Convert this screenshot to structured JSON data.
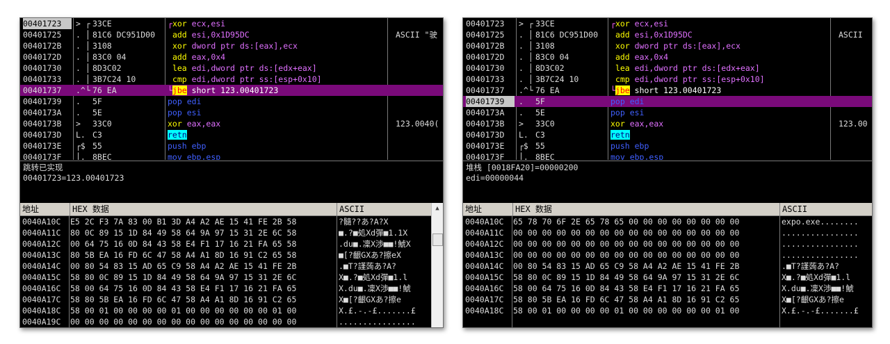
{
  "left": {
    "rows": [
      {
        "addr": "00401723",
        "mark": "> ┌",
        "hex": "33CE",
        "asm": "┌xor ecx,esi",
        "cmt": "",
        "sel": false,
        "hl": true
      },
      {
        "addr": "00401725",
        "mark": ". │",
        "hex": "81C6 DC951D00",
        "asm": " add esi,0x1D95DC",
        "cmt": "ASCII \"驶",
        "sel": false,
        "hl": false
      },
      {
        "addr": "0040172B",
        "mark": ". │",
        "hex": "3108",
        "asm": " xor dword ptr ds:[eax],ecx",
        "cmt": "",
        "sel": false,
        "hl": false
      },
      {
        "addr": "0040172D",
        "mark": ". │",
        "hex": "83C0 04",
        "asm": " add eax,0x4",
        "cmt": "",
        "sel": false,
        "hl": false
      },
      {
        "addr": "00401730",
        "mark": ". │",
        "hex": "8D3C02",
        "asm": " lea edi,dword ptr ds:[edx+eax]",
        "cmt": "",
        "sel": false,
        "hl": false
      },
      {
        "addr": "00401733",
        "mark": ". │",
        "hex": "3B7C24 10",
        "asm": " cmp edi,dword ptr ss:[esp+0x10]",
        "cmt": "",
        "sel": false,
        "hl": false
      },
      {
        "addr": "00401737",
        "mark": ".^└",
        "hex": "76 EA",
        "asm": "└jbe short 123.00401723",
        "cmt": "",
        "sel": true,
        "hl": false
      },
      {
        "addr": "00401739",
        "mark": ".",
        "hex": "5F",
        "asm": "pop edi",
        "cmt": "",
        "sel": false,
        "hl": false
      },
      {
        "addr": "0040173A",
        "mark": ".",
        "hex": "5E",
        "asm": "pop esi",
        "cmt": "",
        "sel": false,
        "hl": false
      },
      {
        "addr": "0040173B",
        "mark": ">",
        "hex": "33C0",
        "asm": "xor eax,eax",
        "cmt": "123.0040(",
        "sel": false,
        "hl": false
      },
      {
        "addr": "0040173D",
        "mark": "L.",
        "hex": "C3",
        "asm": "retn",
        "cmt": "",
        "sel": false,
        "hl": false
      },
      {
        "addr": "0040173E",
        "mark": "┌$",
        "hex": "55",
        "asm": "push ebp",
        "cmt": "",
        "sel": false,
        "hl": false
      },
      {
        "addr": "0040173F",
        "mark": "│.",
        "hex": "8BEC",
        "asm": "mov ebp,esp",
        "cmt": "",
        "sel": false,
        "hl": false
      }
    ],
    "info_line1": "跳转已实现",
    "info_line2": "00401723=123.00401723",
    "dump_header": {
      "addr": "地址",
      "hex": "HEX 数据",
      "ascii": "ASCII"
    },
    "dump": [
      {
        "a": "0040A10C",
        "h": "E5 2C F3 7A 83 00 B1 3D A4 A2 AE 15 41 FE 2B 58",
        "c": "?髓??あ?A?X"
      },
      {
        "a": "0040A11C",
        "h": "80 0C 89 15 1D 84 49 58 64 9A 97 15 31 2E 6C 58",
        "c": "■.?■処Xd彈■1.1X"
      },
      {
        "a": "0040A12C",
        "h": "00 64 75 16 0D 84 43 58 E4 F1 17 16 21 FA 65 58",
        "c": ".du■.凜X渉■■!鯱X"
      },
      {
        "a": "0040A13C",
        "h": "80 5B EA 16 FD 6C 47 58 A4 A1 8D 16 91 C2 65 58",
        "c": "■[?齦GXあ?擦eX"
      },
      {
        "a": "0040A14C",
        "h": "00 80 54 83 15 AD 65 C9 58 A4 A2 AE 15 41 FE 2B",
        "c": ".■T?謹蒟あ?A?"
      },
      {
        "a": "0040A15C",
        "h": "58 80 0C 89 15 1D 84 49 58 64 9A 97 15 31 2E 6C",
        "c": "X■.?■処Xd彈■1.l"
      },
      {
        "a": "0040A16C",
        "h": "58 00 64 75 16 0D 84 43 58 E4 F1 17 16 21 FA 65",
        "c": "X.du■.凜X渉■■!鯱"
      },
      {
        "a": "0040A17C",
        "h": "58 80 5B EA 16 FD 6C 47 58 A4 A1 8D 16 91 C2 65",
        "c": "X■[?齦GXあ?擦e"
      },
      {
        "a": "0040A18C",
        "h": "58 00 01 00 00 00 00 01 00 00 00 00 00 00 01 00",
        "c": "X.£.-.-£.......£"
      },
      {
        "a": "0040A19C",
        "h": "00 00 00 00 00 00 00 00 00 00 00 00 00 00 00 00",
        "c": "................"
      }
    ]
  },
  "right": {
    "rows": [
      {
        "addr": "00401723",
        "mark": "> ┌",
        "hex": "33CE",
        "asm": "┌xor ecx,esi",
        "cmt": "",
        "sel": false,
        "hl": false
      },
      {
        "addr": "00401725",
        "mark": ". │",
        "hex": "81C6 DC951D00",
        "asm": " add esi,0x1D95DC",
        "cmt": "ASCII",
        "sel": false,
        "hl": false
      },
      {
        "addr": "0040172B",
        "mark": ". │",
        "hex": "3108",
        "asm": " xor dword ptr ds:[eax],ecx",
        "cmt": "",
        "sel": false,
        "hl": false
      },
      {
        "addr": "0040172D",
        "mark": ". │",
        "hex": "83C0 04",
        "asm": " add eax,0x4",
        "cmt": "",
        "sel": false,
        "hl": false
      },
      {
        "addr": "00401730",
        "mark": ". │",
        "hex": "8D3C02",
        "asm": " lea edi,dword ptr ds:[edx+eax]",
        "cmt": "",
        "sel": false,
        "hl": false
      },
      {
        "addr": "00401733",
        "mark": ". │",
        "hex": "3B7C24 10",
        "asm": " cmp edi,dword ptr ss:[esp+0x10]",
        "cmt": "",
        "sel": false,
        "hl": false
      },
      {
        "addr": "00401737",
        "mark": ".^└",
        "hex": "76 EA",
        "asm": "└jbe short 123.00401723",
        "cmt": "",
        "sel": false,
        "hl": false
      },
      {
        "addr": "00401739",
        "mark": ".",
        "hex": "5F",
        "asm": "pop edi",
        "cmt": "",
        "sel": true,
        "hl": true
      },
      {
        "addr": "0040173A",
        "mark": ".",
        "hex": "5E",
        "asm": "pop esi",
        "cmt": "",
        "sel": false,
        "hl": false
      },
      {
        "addr": "0040173B",
        "mark": ">",
        "hex": "33C0",
        "asm": "xor eax,eax",
        "cmt": "123.00",
        "sel": false,
        "hl": false
      },
      {
        "addr": "0040173D",
        "mark": "L.",
        "hex": "C3",
        "asm": "retn",
        "cmt": "",
        "sel": false,
        "hl": false
      },
      {
        "addr": "0040173E",
        "mark": "┌$",
        "hex": "55",
        "asm": "push ebp",
        "cmt": "",
        "sel": false,
        "hl": false
      },
      {
        "addr": "0040173F",
        "mark": "│.",
        "hex": "8BEC",
        "asm": "mov ebp,esp",
        "cmt": "",
        "sel": false,
        "hl": false
      }
    ],
    "info_line1": "堆栈 [0018FA20]=00000200",
    "info_line2": "edi=00000044",
    "dump_header": {
      "addr": "地址",
      "hex": "HEX 数据",
      "ascii": "ASCII"
    },
    "dump": [
      {
        "a": "0040A10C",
        "h": "65 78 70 6F 2E 65 78 65 00 00 00 00 00 00 00 00",
        "c": "expo.exe........"
      },
      {
        "a": "0040A11C",
        "h": "00 00 00 00 00 00 00 00 00 00 00 00 00 00 00 00",
        "c": "................"
      },
      {
        "a": "0040A12C",
        "h": "00 00 00 00 00 00 00 00 00 00 00 00 00 00 00 00",
        "c": "................"
      },
      {
        "a": "0040A13C",
        "h": "00 00 00 00 00 00 00 00 00 00 00 00 00 00 00 00",
        "c": "................"
      },
      {
        "a": "0040A14C",
        "h": "00 80 54 83 15 AD 65 C9 58 A4 A2 AE 15 41 FE 2B",
        "c": ".■T?謹蒟あ?A?"
      },
      {
        "a": "0040A15C",
        "h": "58 80 0C 89 15 1D 84 49 58 64 9A 97 15 31 2E 6C",
        "c": "X■.?■処Xd彈■1.l"
      },
      {
        "a": "0040A16C",
        "h": "58 00 64 75 16 0D 84 43 58 E4 F1 17 16 21 FA 65",
        "c": "X.du■.凜X渉■■!鯱"
      },
      {
        "a": "0040A17C",
        "h": "58 80 5B EA 16 FD 6C 47 58 A4 A1 8D 16 91 C2 65",
        "c": "X■[?齦GXあ?擦e"
      },
      {
        "a": "0040A18C",
        "h": "58 00 01 00 00 00 00 01 00 00 00 00 00 00 01 00",
        "c": "X.£.-.-£.......£"
      }
    ]
  }
}
